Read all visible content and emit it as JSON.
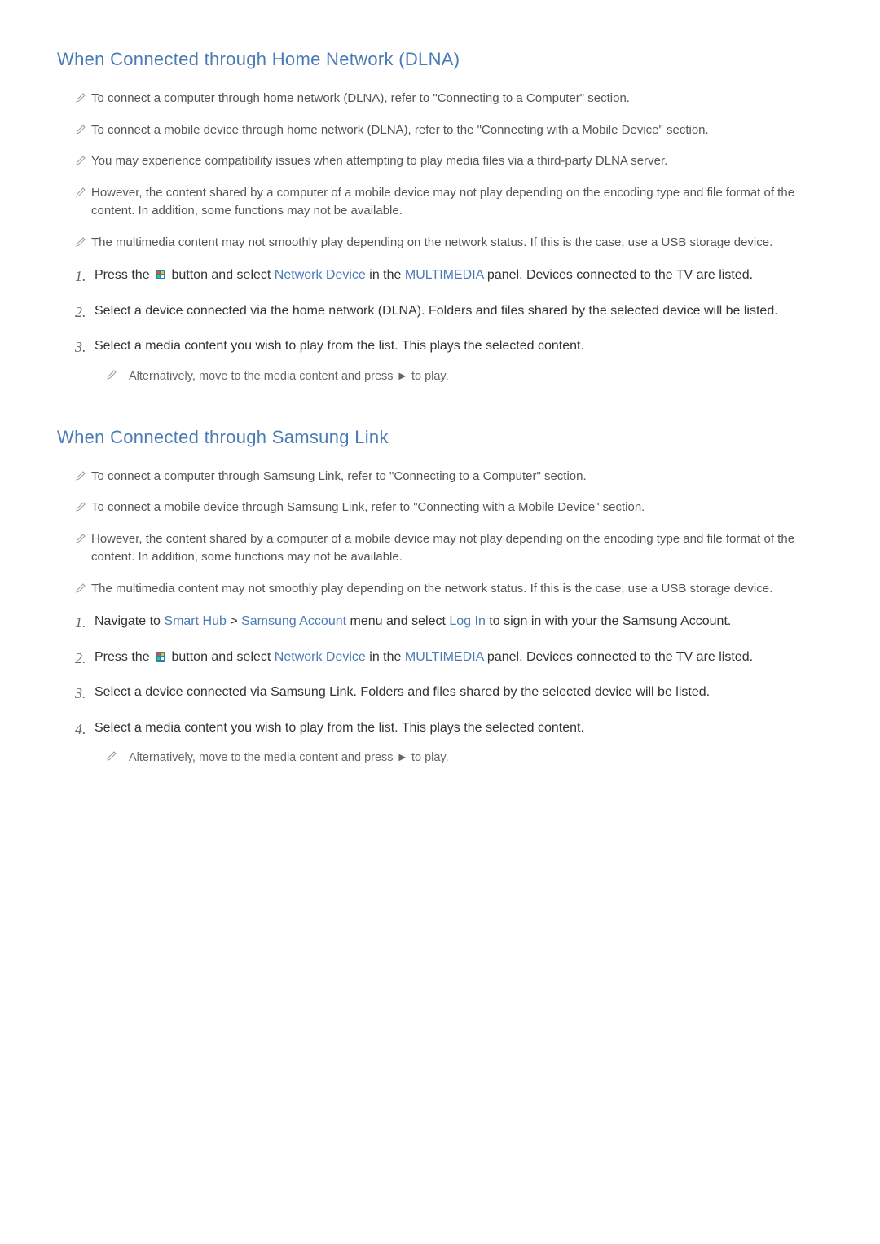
{
  "sections": [
    {
      "heading": "When Connected through Home Network (DLNA)",
      "notes": [
        "To connect a computer through home network (DLNA), refer to \"Connecting to a Computer\" section.",
        "To connect a mobile device through home network (DLNA), refer to the \"Connecting with a Mobile Device\" section.",
        "You may experience compatibility issues when attempting to play media files via a third-party DLNA server.",
        "However, the content shared by a computer of a mobile device may not play depending on the encoding type and file format of the content. In addition, some functions may not be available.",
        "The multimedia content may not smoothly play depending on the network status. If this is the case, use a USB storage device."
      ],
      "steps": [
        {
          "num": "1.",
          "prefix": "Press the ",
          "has_icon": true,
          "mid1": " button and select ",
          "kw1": "Network Device",
          "mid2": " in the ",
          "kw2": "MULTIMEDIA",
          "suffix": " panel. Devices connected to the TV are listed.",
          "sub": null
        },
        {
          "num": "2.",
          "plain": "Select a device connected via the home network (DLNA). Folders and files shared by the selected device will be listed.",
          "sub": null
        },
        {
          "num": "3.",
          "plain": "Select a media content you wish to play from the list. This plays the selected content.",
          "sub": {
            "before": "Alternatively, move to the media content and press ",
            "glyph": "►",
            "after": " to play."
          }
        }
      ]
    },
    {
      "heading": "When Connected through Samsung Link",
      "notes": [
        "To connect a computer through Samsung Link, refer to \"Connecting to a Computer\" section.",
        "To connect a mobile device through Samsung Link, refer to \"Connecting with a Mobile Device\" section.",
        "However, the content shared by a computer of a mobile device may not play depending on the encoding type and file format of the content. In addition, some functions may not be available.",
        "The multimedia content may not smoothly play depending on the network status. If this is the case, use a USB storage device."
      ],
      "steps": [
        {
          "num": "1.",
          "nav_prefix": "Navigate to ",
          "kw1": "Smart Hub",
          "angle": " > ",
          "kw2": "Samsung Account",
          "mid": " menu and select ",
          "kw3": "Log In",
          "suffix": " to sign in with your the Samsung Account.",
          "sub": null
        },
        {
          "num": "2.",
          "prefix": "Press the ",
          "has_icon": true,
          "mid1": " button and select ",
          "kw1b": "Network Device",
          "mid2": " in the ",
          "kw2b": "MULTIMEDIA",
          "suffix2": " panel. Devices connected to the TV are listed.",
          "sub": null
        },
        {
          "num": "3.",
          "plain": "Select a device connected via Samsung Link. Folders and files shared by the selected device will be listed.",
          "sub": null
        },
        {
          "num": "4.",
          "plain": "Select a media content you wish to play from the list. This plays the selected content.",
          "sub": {
            "before": "Alternatively, move to the media content and press ",
            "glyph": "►",
            "after": " to play."
          }
        }
      ]
    }
  ]
}
